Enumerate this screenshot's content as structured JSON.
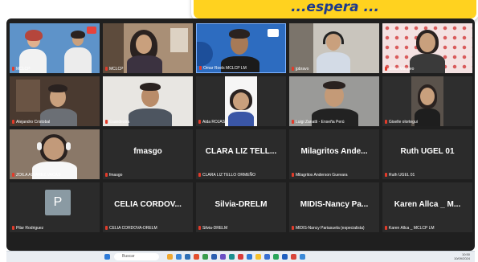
{
  "banner": {
    "text": "...espera ..."
  },
  "tiles": [
    {
      "id": "t1",
      "label": "MCLCP"
    },
    {
      "id": "t2",
      "label": "MCLCP"
    },
    {
      "id": "t3",
      "label": "Omar Roels MCLCP LM"
    },
    {
      "id": "t4",
      "label": "jpbravo"
    },
    {
      "id": "t5",
      "label": "Silvia Mongeo"
    },
    {
      "id": "t6",
      "label": "Alejandro Cristobal"
    },
    {
      "id": "t7",
      "label": "Esandestra"
    },
    {
      "id": "t8",
      "label": "Aida ROJAS"
    },
    {
      "id": "t9",
      "label": "Luigi Zanatti - Enseña Perú"
    },
    {
      "id": "t10",
      "label": "Giselle olortegui"
    },
    {
      "id": "t11",
      "label": "ZOILA ALVAREZ VACAS"
    },
    {
      "id": "t12",
      "label": "fmasgo",
      "big": "fmasgo"
    },
    {
      "id": "t13",
      "label": "CLARA LIZ TELLO ORMEÑO",
      "big": "CLARA LIZ TELL..."
    },
    {
      "id": "t14",
      "label": "Milagritos Anderson Guevara",
      "big": "Milagritos Ande..."
    },
    {
      "id": "t15",
      "label": "Ruth UGEL 01",
      "big": "Ruth UGEL 01"
    },
    {
      "id": "t16",
      "label": "Pilar Rodriguez",
      "avatar": "P"
    },
    {
      "id": "t17",
      "label": "CELIA CORDOVA-DRELM",
      "big": "CELIA CORDOV..."
    },
    {
      "id": "t18",
      "label": "Silvia-DRELM",
      "big": "Silvia-DRELM"
    },
    {
      "id": "t19",
      "label": "MIDIS-Nancy Pariasuela (especialista)",
      "big": "MIDIS-Nancy Pa..."
    },
    {
      "id": "t20",
      "label": "Karen Allca _ MCLCP LM",
      "big": "Karen Allca _ M..."
    }
  ],
  "taskbar": {
    "search_placeholder": "Buscar",
    "time": "10:50",
    "date": "10/09/2024"
  },
  "colors": {
    "banner": "#ffd21f",
    "banner_text": "#1d3a8c",
    "mic_off": "#e23b2a",
    "meet_bg": "#1f1f1f"
  }
}
